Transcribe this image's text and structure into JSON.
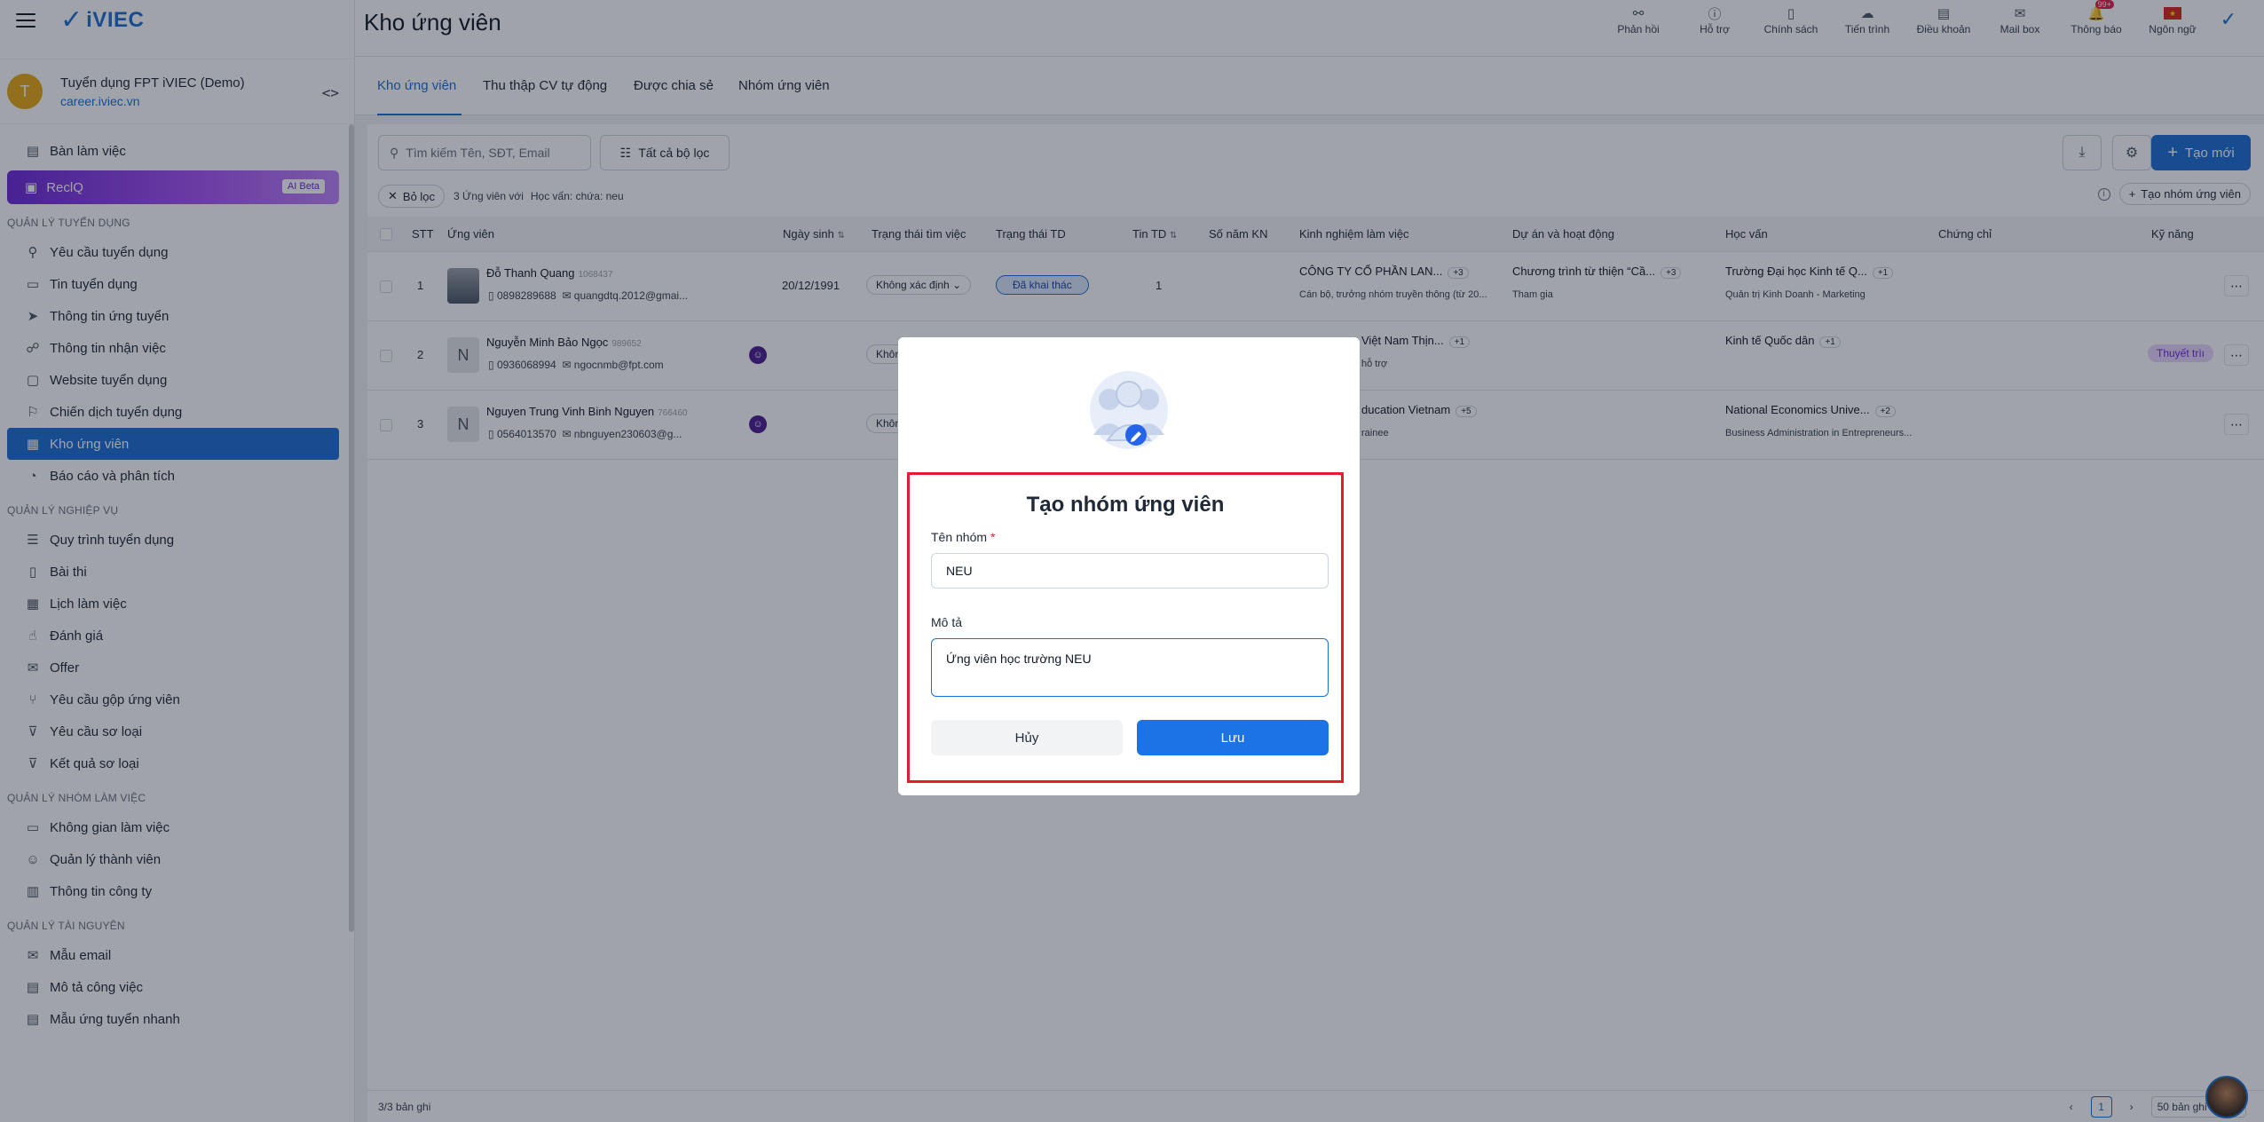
{
  "app": {
    "brand": "iVIEC",
    "page_title": "Kho ứng viên"
  },
  "company": {
    "initial": "T",
    "name": "Tuyển dụng FPT iVIEC (Demo)",
    "url": "career.iviec.vn"
  },
  "top_actions": [
    {
      "label": "Phản hồi",
      "icon": "feedback-icon"
    },
    {
      "label": "Hỗ trợ",
      "icon": "help-icon"
    },
    {
      "label": "Chính sách",
      "icon": "policy-icon"
    },
    {
      "label": "Tiến trình",
      "icon": "progress-icon"
    },
    {
      "label": "Điều khoản",
      "icon": "terms-icon"
    },
    {
      "label": "Mail box",
      "icon": "mail-icon"
    },
    {
      "label": "Thông báo",
      "icon": "bell-icon",
      "badge": "99+"
    },
    {
      "label": "Ngôn ngữ",
      "icon": "flag-icon"
    }
  ],
  "sidebar": {
    "top_items": [
      {
        "label": "Bàn làm việc"
      }
    ],
    "reciq": {
      "label": "ReclQ",
      "badge": "AI Beta"
    },
    "sections": [
      {
        "title": "QUẢN LÝ TUYỂN DỤNG",
        "items": [
          "Yêu cầu tuyển dụng",
          "Tin tuyển dụng",
          "Thông tin ứng tuyển",
          "Thông tin nhận việc",
          "Website tuyển dụng",
          "Chiến dịch tuyển dụng",
          "Kho ứng viên",
          "Báo cáo và phân tích"
        ]
      },
      {
        "title": "QUẢN LÝ NGHIỆP VỤ",
        "items": [
          "Quy trình tuyển dụng",
          "Bài thi",
          "Lịch làm việc",
          "Đánh giá",
          "Offer",
          "Yêu cầu gộp ứng viên",
          "Yêu cầu sơ loại",
          "Kết quả sơ loại"
        ]
      },
      {
        "title": "QUẢN LÝ NHÓM LÀM VIỆC",
        "items": [
          "Không gian làm việc",
          "Quản lý thành viên",
          "Thông tin công ty"
        ]
      },
      {
        "title": "QUẢN LÝ TÀI NGUYÊN",
        "items": [
          "Mẫu email",
          "Mô tả công việc",
          "Mẫu ứng tuyển nhanh"
        ]
      }
    ],
    "active": "Kho ứng viên"
  },
  "tabs": [
    "Kho ứng viên",
    "Thu thập CV tự động",
    "Được chia sẻ",
    "Nhóm ứng viên"
  ],
  "toolbar": {
    "search_placeholder": "Tìm kiếm Tên, SĐT, Email",
    "filter_all": "Tất cả bộ lọc",
    "create": "Tạo mới"
  },
  "filter": {
    "clear": "Bỏ lọc",
    "count": "3 Ứng viên với",
    "condition": "Học vấn: chứa: neu",
    "create_group": "Tạo nhóm ứng viên"
  },
  "columns": [
    "STT",
    "Ứng viên",
    "Ngày sinh",
    "Trạng thái tìm việc",
    "Trạng thái TD",
    "Tin TD",
    "Số năm KN",
    "Kinh nghiệm làm việc",
    "Dự án và hoạt động",
    "Học vấn",
    "Chứng chỉ",
    "Kỹ năng"
  ],
  "rows": [
    {
      "stt": "1",
      "name": "Đỗ Thanh Quang",
      "code": "1068437",
      "phone": "0898289688",
      "email": "quangdtq.2012@gmai...",
      "dob": "20/12/1991",
      "job_status": "Không xác định",
      "td_status": "Đã khai thác",
      "tin_td": "1",
      "exp": "CÔNG TY CỔ PHẦN LAN...",
      "exp_more": "+3",
      "exp_sub": "Cán bộ, trưởng nhóm truyền thông (từ 20...",
      "project": "Chương trình từ thiện “Cầ...",
      "project_more": "+3",
      "project_sub": "Tham gia",
      "edu": "Trường Đại học Kinh tế Q...",
      "edu_more": "+1",
      "edu_sub": "Quản trị Kinh Doanh - Marketing",
      "skill": ""
    },
    {
      "stt": "2",
      "initial": "N",
      "name": "Nguyễn Minh Bảo Ngọc",
      "code": "989652",
      "phone": "0936068994",
      "email": "ngocnmb@fpt.com",
      "job_status": "Khôn",
      "exp": "Việt Nam Thịn...",
      "exp_more": "+1",
      "exp_sub": "hỗ trợ",
      "edu": "Kinh tế Quốc dân",
      "edu_more": "+1",
      "skill": "Thuyết trìı"
    },
    {
      "stt": "3",
      "initial": "N",
      "name": "Nguyen Trung Vinh Binh Nguyen",
      "code": "766460",
      "phone": "0564013570",
      "email": "nbnguyen230603@g...",
      "job_status": "Khôn",
      "exp": "ducation Vietnam",
      "exp_more": "+5",
      "exp_sub": "rainee",
      "edu": "National Economics Unive...",
      "edu_more": "+2",
      "edu_sub": "Business Administration in Entrepreneurs..."
    }
  ],
  "footer": {
    "count": "3/3 bản ghi",
    "page": "1",
    "per_page": "50 bản ghi / Tra..."
  },
  "modal": {
    "title": "Tạo nhóm ứng viên",
    "name_label": "Tên nhóm",
    "name_required": "*",
    "name_value": "NEU",
    "desc_label": "Mô tả",
    "desc_value": "Ứng viên học trường NEU",
    "cancel": "Hủy",
    "save": "Lưu"
  }
}
